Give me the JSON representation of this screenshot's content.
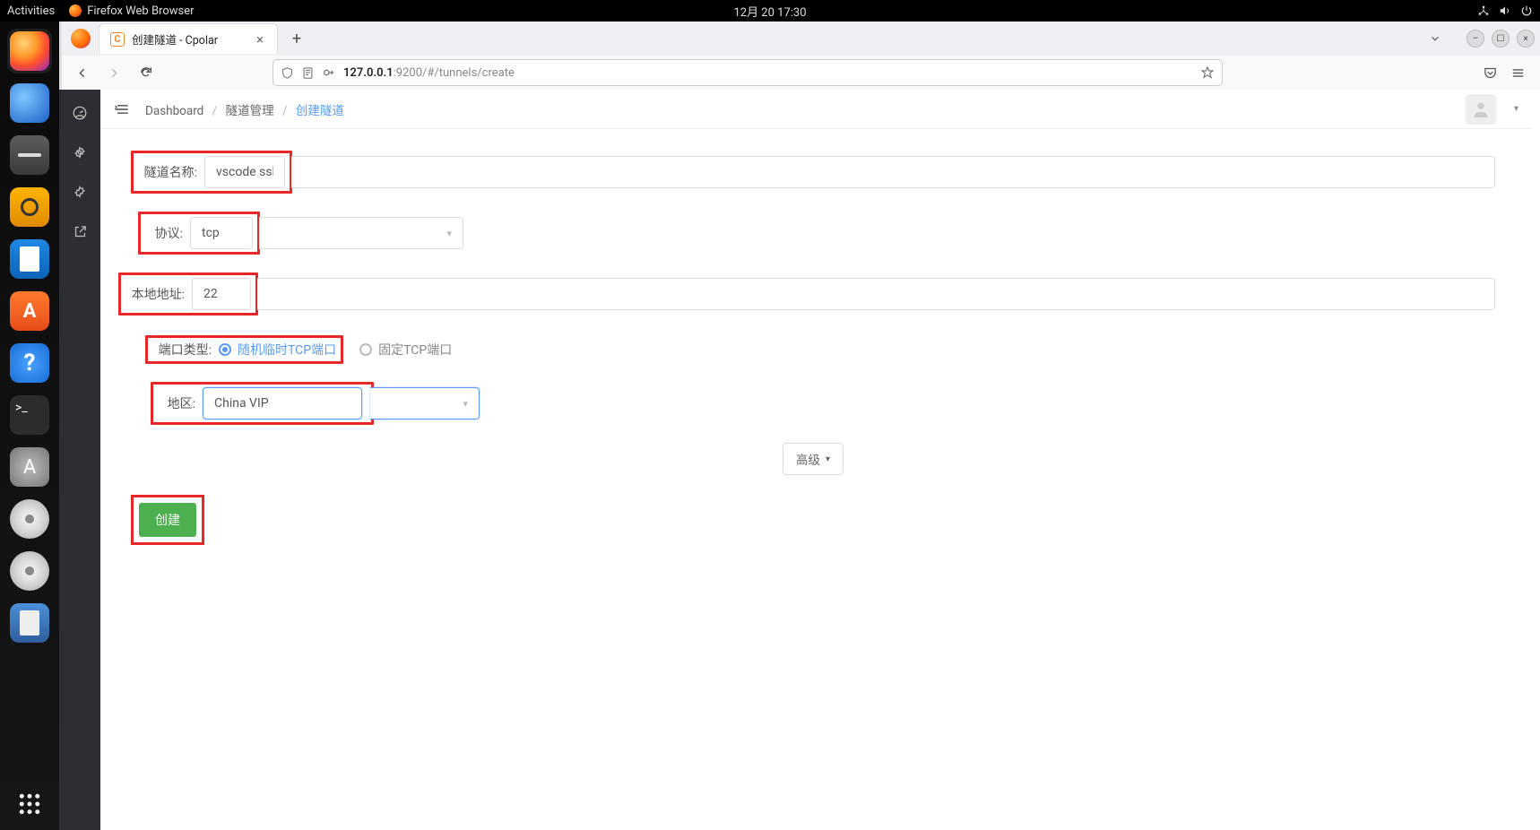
{
  "gnome": {
    "activities": "Activities",
    "app_label": "Firefox Web Browser",
    "datetime": "12月 20  17:30"
  },
  "browser": {
    "tab_title": "创建隧道 - Cpolar",
    "tab_favicon_letter": "C",
    "url_host": "127.0.0.1",
    "url_port_path": ":9200/#/tunnels/create"
  },
  "breadcrumb": {
    "item0": "Dashboard",
    "item1": "隧道管理",
    "item2": "创建隧道"
  },
  "form": {
    "name_label": "隧道名称:",
    "name_value": "vscode ssh",
    "protocol_label": "协议:",
    "protocol_value": "tcp",
    "local_addr_label": "本地地址:",
    "local_addr_value": "22",
    "port_type_label": "端口类型:",
    "port_type_opt1": "随机临时TCP端口",
    "port_type_opt2": "固定TCP端口",
    "region_label": "地区:",
    "region_value": "China VIP",
    "advanced": "高级",
    "submit": "创建"
  }
}
